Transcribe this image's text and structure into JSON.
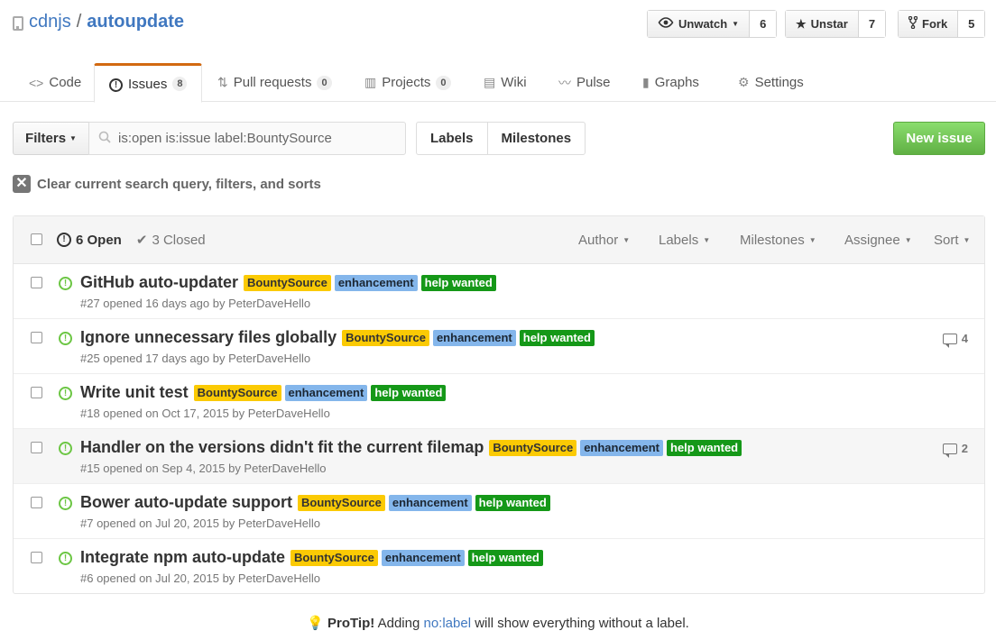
{
  "repo": {
    "owner": "cdnjs",
    "separator": "/",
    "name": "autoupdate"
  },
  "actions": {
    "watch": {
      "label": "Unwatch",
      "count": "6"
    },
    "star": {
      "label": "Unstar",
      "count": "7"
    },
    "fork": {
      "label": "Fork",
      "count": "5"
    }
  },
  "tabs": [
    {
      "label": "Code",
      "icon": "code-icon"
    },
    {
      "label": "Issues",
      "count": "8",
      "icon": "issue-opened-icon",
      "selected": true
    },
    {
      "label": "Pull requests",
      "count": "0",
      "icon": "pull-request-icon"
    },
    {
      "label": "Projects",
      "count": "0",
      "icon": "project-icon"
    },
    {
      "label": "Wiki",
      "icon": "book-icon"
    },
    {
      "label": "Pulse",
      "icon": "pulse-icon"
    },
    {
      "label": "Graphs",
      "icon": "graph-icon"
    },
    {
      "label": "Settings",
      "icon": "gear-icon"
    }
  ],
  "filters": {
    "button_label": "Filters",
    "search_value": "is:open is:issue label:BountySource",
    "labels_label": "Labels",
    "milestones_label": "Milestones",
    "new_issue_label": "New issue",
    "clear_text": "Clear current search query, filters, and sorts"
  },
  "list_header": {
    "open": "6 Open",
    "closed": "3 Closed",
    "author": "Author",
    "labels": "Labels",
    "milestones": "Milestones",
    "assignee": "Assignee",
    "sort": "Sort"
  },
  "issues": [
    {
      "title": "GitHub auto-updater",
      "labels": [
        "BountySource",
        "enhancement",
        "help wanted"
      ],
      "meta": "#27 opened 16 days ago by PeterDaveHello",
      "comments": ""
    },
    {
      "title": "Ignore unnecessary files globally",
      "labels": [
        "BountySource",
        "enhancement",
        "help wanted"
      ],
      "meta": "#25 opened 17 days ago by PeterDaveHello",
      "comments": "4"
    },
    {
      "title": "Write unit test",
      "labels": [
        "BountySource",
        "enhancement",
        "help wanted"
      ],
      "meta": "#18 opened on Oct 17, 2015 by PeterDaveHello",
      "comments": ""
    },
    {
      "title": "Handler on the versions didn't fit the current filemap",
      "labels": [
        "BountySource",
        "enhancement",
        "help wanted"
      ],
      "meta": "#15 opened on Sep 4, 2015 by PeterDaveHello",
      "comments": "2"
    },
    {
      "title": "Bower auto-update support",
      "labels": [
        "BountySource",
        "enhancement",
        "help wanted"
      ],
      "meta": "#7 opened on Jul 20, 2015 by PeterDaveHello",
      "comments": ""
    },
    {
      "title": "Integrate npm auto-update",
      "labels": [
        "BountySource",
        "enhancement",
        "help wanted"
      ],
      "meta": "#6 opened on Jul 20, 2015 by PeterDaveHello",
      "comments": ""
    }
  ],
  "protip": {
    "strong": "ProTip!",
    "before": "Adding",
    "link": "no:label",
    "after": "will show everything without a label."
  },
  "colors": {
    "label_bountysource": "#fbca04",
    "label_enhancement": "#84b6eb",
    "label_help_wanted": "#159818",
    "new_issue": "#6cc644",
    "accent_tab": "#d26911"
  }
}
